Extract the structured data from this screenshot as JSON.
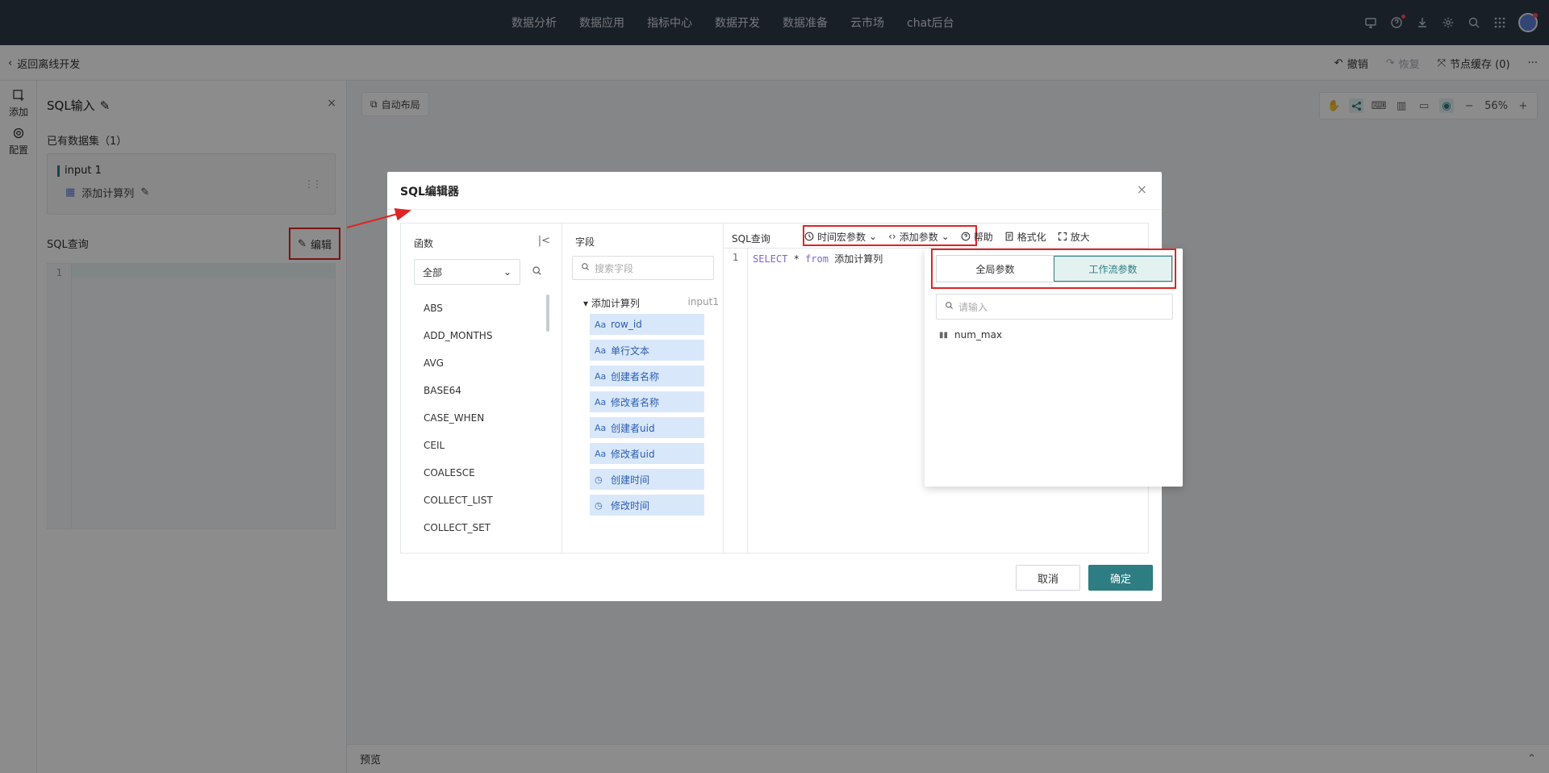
{
  "topnav": {
    "items": [
      "数据分析",
      "数据应用",
      "指标中心",
      "数据开发",
      "数据准备",
      "云市场",
      "chat后台"
    ]
  },
  "topicons": [
    "monitor-icon",
    "help-icon",
    "download-icon",
    "gear-icon",
    "search-icon",
    "apps-grid-icon"
  ],
  "subbar": {
    "back_label": "返回离线开发",
    "undo_label": "撤销",
    "redo_label": "恢复",
    "node_cache_label": "节点缓存 (0)",
    "more_label": "···"
  },
  "rail": {
    "add_label": "添加",
    "config_label": "配置"
  },
  "panel": {
    "title": "SQL输入",
    "close": "×",
    "datasets_label": "已有数据集（1）",
    "dataset_name": "input 1",
    "dataset_table": "添加计算列",
    "sql_label": "SQL查询",
    "edit_label": "编辑",
    "line1": "1"
  },
  "canvas": {
    "auto_layout_label": "自动布局",
    "zoom": "56%",
    "preview_label": "预览"
  },
  "modal": {
    "title": "SQL编辑器",
    "close": "×",
    "functions": {
      "header": "函数",
      "category": "全部",
      "items": [
        "ABS",
        "ADD_MONTHS",
        "AVG",
        "BASE64",
        "CASE_WHEN",
        "CEIL",
        "COALESCE",
        "COLLECT_LIST",
        "COLLECT_SET"
      ]
    },
    "fields": {
      "header": "字段",
      "search_placeholder": "搜索字段",
      "group_name": "添加计算列",
      "group_source": "input1",
      "items": [
        {
          "name": "row_id",
          "icon": "Aa"
        },
        {
          "name": "单行文本",
          "icon": "Aa"
        },
        {
          "name": "创建者名称",
          "icon": "Aa"
        },
        {
          "name": "修改者名称",
          "icon": "Aa"
        },
        {
          "name": "创建者uid",
          "icon": "Aa"
        },
        {
          "name": "修改者uid",
          "icon": "Aa"
        },
        {
          "name": "创建时间",
          "icon": "date-icon"
        },
        {
          "name": "修改时间",
          "icon": "date-icon"
        }
      ]
    },
    "sql": {
      "header": "SQL查询",
      "time_macro_label": "时间宏参数",
      "add_param_label": "添加参数",
      "help_label": "帮助",
      "format_label": "格式化",
      "zoom_label": "放大",
      "line_no": "1",
      "kw_select": "SELECT",
      "star": "*",
      "kw_from": "from",
      "table": "添加计算列"
    },
    "cancel_label": "取消",
    "ok_label": "确定"
  },
  "param_dropdown": {
    "tab_global": "全局参数",
    "tab_workflow": "工作流参数",
    "search_placeholder": "请输入",
    "items": [
      "num_max"
    ]
  },
  "colors": {
    "accent": "#2d7d82",
    "highlight_red": "#e02424",
    "field_bg": "#d9e7fa"
  }
}
